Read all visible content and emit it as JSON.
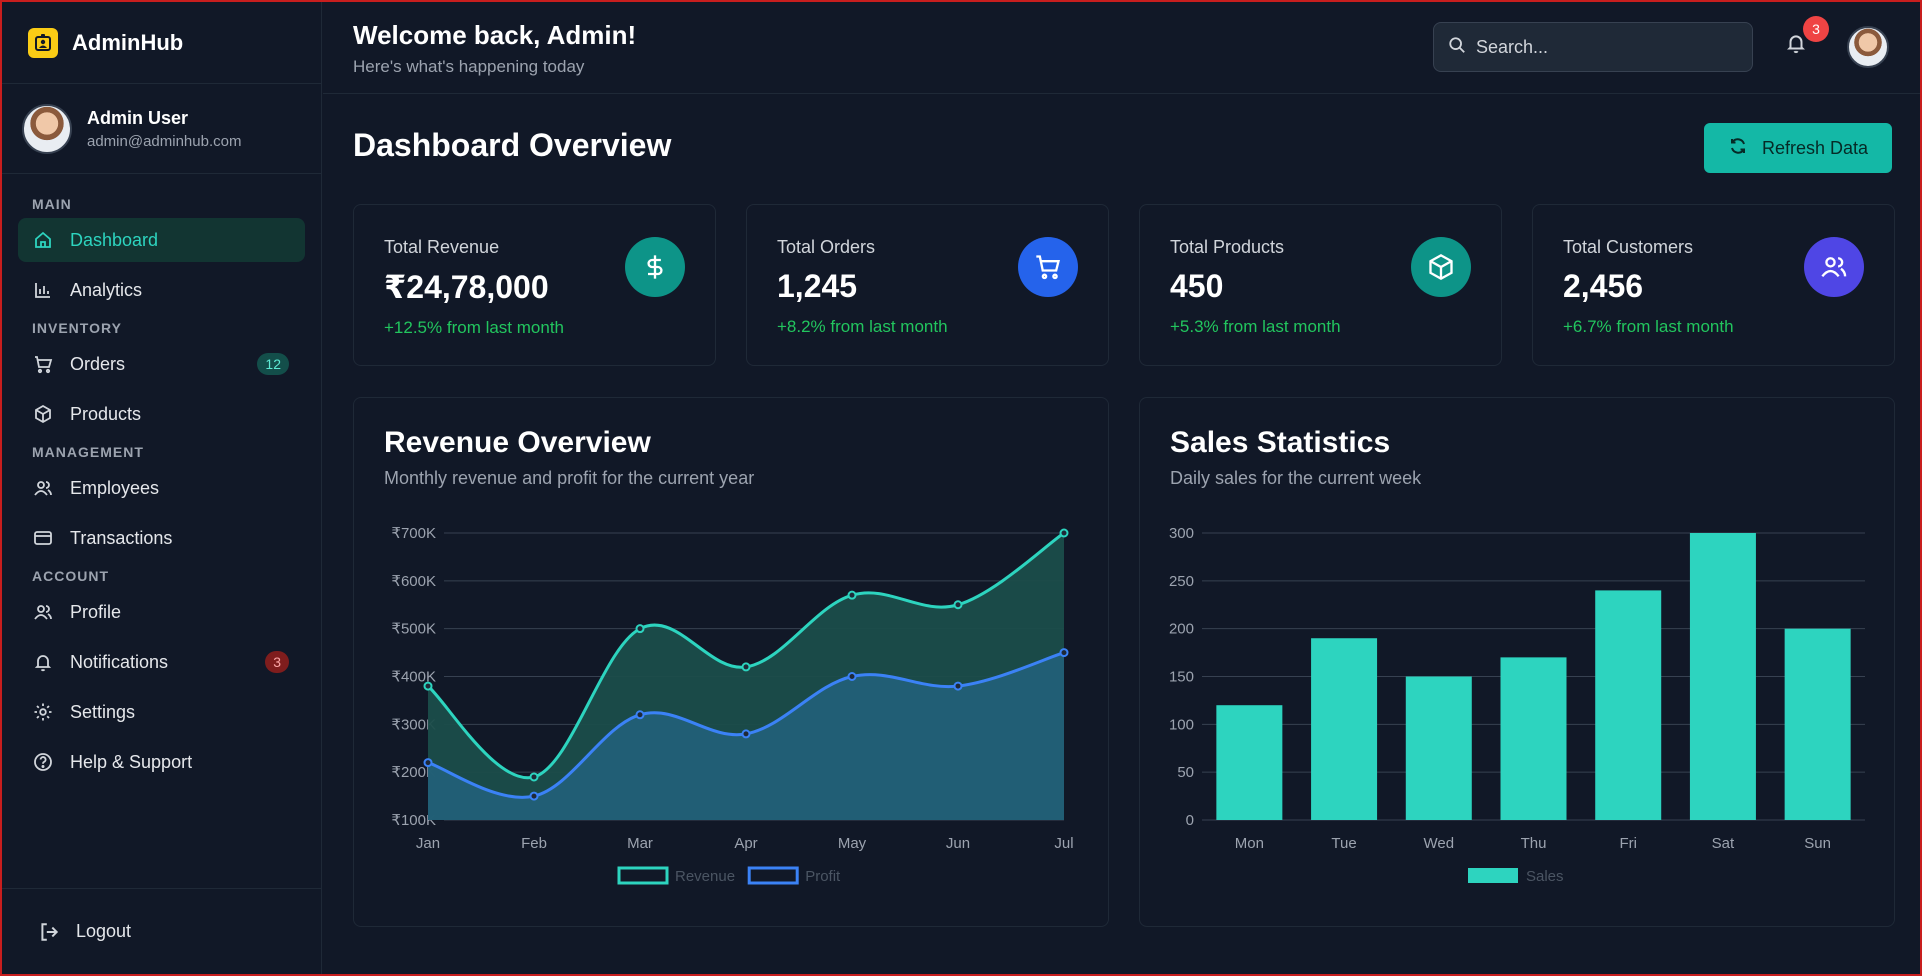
{
  "brand": {
    "name": "AdminHub",
    "logo_icon": "badge-icon",
    "logo_color": "#facc15"
  },
  "user": {
    "name": "Admin User",
    "email": "admin@adminhub.com"
  },
  "nav": {
    "sections": [
      "MAIN",
      "INVENTORY",
      "MANAGEMENT",
      "ACCOUNT"
    ],
    "items": [
      {
        "label": "Dashboard",
        "icon": "home-icon",
        "active": true
      },
      {
        "label": "Analytics",
        "icon": "bar-chart-icon"
      },
      {
        "label": "Orders",
        "icon": "cart-icon",
        "badge": "12"
      },
      {
        "label": "Products",
        "icon": "box-icon"
      },
      {
        "label": "Employees",
        "icon": "users-icon"
      },
      {
        "label": "Transactions",
        "icon": "credit-card-icon"
      },
      {
        "label": "Profile",
        "icon": "user-icon"
      },
      {
        "label": "Notifications",
        "icon": "bell-icon",
        "badge": "3"
      },
      {
        "label": "Settings",
        "icon": "gear-icon"
      },
      {
        "label": "Help & Support",
        "icon": "help-icon"
      }
    ],
    "logout": "Logout"
  },
  "header": {
    "title": "Welcome back, Admin!",
    "subtitle": "Here's what's happening today",
    "search_placeholder": "Search...",
    "notification_count": "3"
  },
  "page": {
    "title": "Dashboard Overview",
    "refresh_label": "Refresh Data"
  },
  "stats": [
    {
      "label": "Total Revenue",
      "value": "₹24,78,000",
      "change": "+12.5% from last month",
      "icon": "dollar-icon",
      "color": "#0d9488"
    },
    {
      "label": "Total Orders",
      "value": "1,245",
      "change": "+8.2% from last month",
      "icon": "cart-icon",
      "color": "#2563eb"
    },
    {
      "label": "Total Products",
      "value": "450",
      "change": "+5.3% from last month",
      "icon": "box-icon",
      "color": "#0d9488"
    },
    {
      "label": "Total Customers",
      "value": "2,456",
      "change": "+6.7% from last month",
      "icon": "users-icon",
      "color": "#4f46e5"
    }
  ],
  "revenue_card": {
    "title": "Revenue Overview",
    "subtitle": "Monthly revenue and profit for the current year"
  },
  "sales_card": {
    "title": "Sales Statistics",
    "subtitle": "Daily sales for the current week"
  },
  "chart_data": [
    {
      "type": "area",
      "title": "Revenue Overview",
      "categories": [
        "Jan",
        "Feb",
        "Mar",
        "Apr",
        "May",
        "Jun",
        "Jul"
      ],
      "series": [
        {
          "name": "Revenue",
          "values": [
            380,
            190,
            500,
            420,
            570,
            550,
            700
          ],
          "color": "#2dd4bf"
        },
        {
          "name": "Profit",
          "values": [
            220,
            150,
            320,
            280,
            400,
            380,
            450
          ],
          "color": "#3b82f6"
        }
      ],
      "yticks": [
        "₹100K",
        "₹200K",
        "₹300K",
        "₹400K",
        "₹500K",
        "₹600K",
        "₹700K"
      ],
      "ylim": [
        100,
        700
      ],
      "grid": true,
      "legend": "bottom"
    },
    {
      "type": "bar",
      "title": "Sales Statistics",
      "categories": [
        "Mon",
        "Tue",
        "Wed",
        "Thu",
        "Fri",
        "Sat",
        "Sun"
      ],
      "series": [
        {
          "name": "Sales",
          "values": [
            120,
            190,
            150,
            170,
            240,
            300,
            200
          ],
          "color": "#2dd4bf"
        }
      ],
      "yticks": [
        "0",
        "50",
        "100",
        "150",
        "200",
        "250",
        "300"
      ],
      "ylim": [
        0,
        300
      ],
      "grid": true,
      "legend": "bottom"
    }
  ]
}
